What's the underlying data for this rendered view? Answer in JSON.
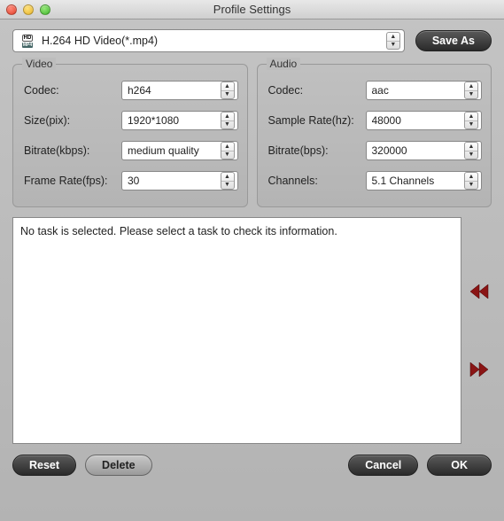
{
  "window": {
    "title": "Profile Settings"
  },
  "profile": {
    "label": "H.264 HD Video(*.mp4)"
  },
  "buttons": {
    "save_as": "Save As",
    "reset": "Reset",
    "delete": "Delete",
    "cancel": "Cancel",
    "ok": "OK"
  },
  "video": {
    "title": "Video",
    "codec_label": "Codec:",
    "codec_value": "h264",
    "size_label": "Size(pix):",
    "size_value": "1920*1080",
    "bitrate_label": "Bitrate(kbps):",
    "bitrate_value": "medium quality",
    "framerate_label": "Frame Rate(fps):",
    "framerate_value": "30"
  },
  "audio": {
    "title": "Audio",
    "codec_label": "Codec:",
    "codec_value": "aac",
    "samplerate_label": "Sample Rate(hz):",
    "samplerate_value": "48000",
    "bitrate_label": "Bitrate(bps):",
    "bitrate_value": "320000",
    "channels_label": "Channels:",
    "channels_value": "5.1 Channels"
  },
  "task": {
    "empty_message": "No task is selected. Please select a task to check its information."
  }
}
